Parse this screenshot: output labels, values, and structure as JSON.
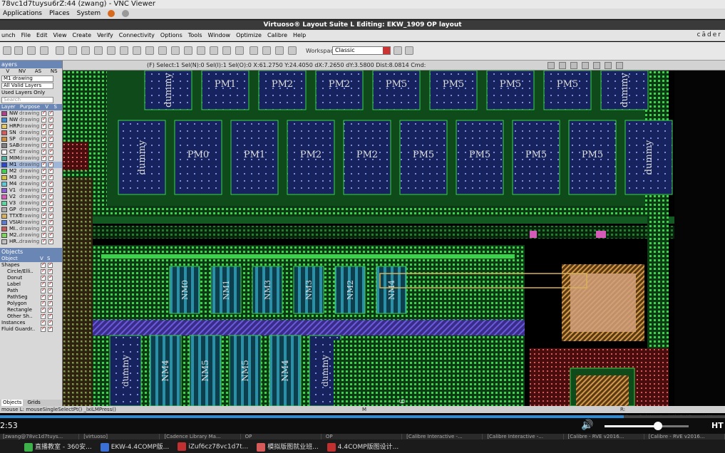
{
  "window": {
    "vnc_title": "78vc1d7tuysu6rZ:44 (zwang) - VNC Viewer"
  },
  "gnome": {
    "items": [
      "Applications",
      "Places",
      "System"
    ]
  },
  "app": {
    "title": "Virtuoso® Layout Suite L Editing: EKW_1909 OP layout",
    "brand": "cāder"
  },
  "menu": [
    "unch",
    "File",
    "Edit",
    "View",
    "Create",
    "Verify",
    "Connectivity",
    "Options",
    "Tools",
    "Window",
    "Optimize",
    "Calibre",
    "Help"
  ],
  "toolbar": {
    "workspace_label": "Workspace:",
    "workspace_value": "Classic"
  },
  "status": {
    "text": "(F) Select:1 Sel(N):0 Sel(I):1 Sel(O):0   X:61.2750 Y:24.4050 dX:7.2650 dY:3.5800 Dist:8.0814 Cmd:"
  },
  "layers": {
    "title": "ayers",
    "cols": [
      "V",
      "NV",
      "AS",
      "NS"
    ],
    "current": "M1 drawing",
    "filter": "All Valid Layers",
    "used": "Used Layers Only",
    "search": "Search",
    "headers": [
      "Layer",
      "Purpose",
      "V",
      "S"
    ],
    "rows": [
      {
        "name": "NW",
        "purpose": "drawing",
        "color": "#b23d8a"
      },
      {
        "name": "NW",
        "purpose": "drawing",
        "color": "#3e8ad7"
      },
      {
        "name": "HRP",
        "purpose": "drawing",
        "color": "#e6c85e"
      },
      {
        "name": "SN",
        "purpose": "drawing",
        "color": "#d85a5a"
      },
      {
        "name": "SP",
        "purpose": "drawing",
        "color": "#cf8c3a"
      },
      {
        "name": "SAB",
        "purpose": "drawing",
        "color": "#7f7f7f"
      },
      {
        "name": "CT",
        "purpose": "drawing",
        "color": "#ffffff"
      },
      {
        "name": "MIM",
        "purpose": "drawing",
        "color": "#4fb0a0"
      },
      {
        "name": "M1",
        "purpose": "drawing",
        "color": "#2c47d4",
        "selected": true
      },
      {
        "name": "M2",
        "purpose": "drawing",
        "color": "#3bd34b"
      },
      {
        "name": "M3",
        "purpose": "drawing",
        "color": "#d3c23b"
      },
      {
        "name": "M4",
        "purpose": "drawing",
        "color": "#5ec9d6"
      },
      {
        "name": "V1",
        "purpose": "drawing",
        "color": "#8b5ad6"
      },
      {
        "name": "V2",
        "purpose": "drawing",
        "color": "#d65ab8"
      },
      {
        "name": "V3",
        "purpose": "drawing",
        "color": "#5ad6a0"
      },
      {
        "name": "GP",
        "purpose": "drawing",
        "color": "#aaaaaa"
      },
      {
        "name": "TTXT",
        "purpose": "drawing",
        "color": "#d6b25a"
      },
      {
        "name": "VSIA",
        "purpose": "drawing",
        "color": "#5a7ad6"
      },
      {
        "name": "MI..",
        "purpose": "drawing",
        "color": "#c45a5a"
      },
      {
        "name": "M2..",
        "purpose": "drawing",
        "color": "#7ad65a"
      },
      {
        "name": "HR..",
        "purpose": "drawing",
        "color": "#c0c0c0"
      }
    ]
  },
  "objects": {
    "title": "Objects",
    "header": [
      "Object",
      "V",
      "S"
    ],
    "rows": [
      "Shapes",
      "Circle/Elli..",
      "Donut",
      "Label",
      "Path",
      "PathSeg",
      "Polygon",
      "Rectangle",
      "Other Sh..",
      "Instances",
      "Fluid Guardr.."
    ],
    "tabs": [
      "Objects",
      "Grids"
    ]
  },
  "devices": {
    "top_row": [
      "dummy",
      "PM1",
      "PM2",
      "PM2",
      "PM5",
      "PM5",
      "PM5",
      "PM5",
      "dummy"
    ],
    "mid_row": [
      "dummy",
      "PM0",
      "PM1",
      "PM2",
      "PM2",
      "PM5",
      "PM5",
      "PM5",
      "PM5",
      "dummy"
    ],
    "nmos_row": [
      "NM0",
      "NM1",
      "NM3",
      "NM3",
      "NM2",
      "NM4"
    ],
    "bottom_row": [
      "dummy",
      "NM4",
      "NM5",
      "NM5",
      "NM4",
      "dummy"
    ],
    "small_label": "6"
  },
  "cmdline": {
    "left": "mouse L: mouseSingleSelectPt() _lxiLMPress()",
    "mid": "M",
    "right": "R: hiZoomRelativeScale(hiGetCurrentWindow()"
  },
  "video": {
    "time": "2:53",
    "quality": "HT",
    "progress": 0.86,
    "volume": 0.64
  },
  "taskbar": {
    "top": [
      "[zwang@78vc1d7tuys...",
      "[virtuoso]",
      "[Cadence Library Ma...",
      "OP",
      "OP",
      "[Calibre Interactive -...",
      "[Calibre Interactive -...",
      "[Calibre - RVE v2016...",
      "[Calibre - RVE v2016..."
    ],
    "bottom": [
      "直播教室 - 360安...",
      "EKW-4.4COMP版...",
      "iZuf6cz78vc1d7t...",
      "模拟版图就业班...",
      "4.4COMP版图设计..."
    ]
  }
}
